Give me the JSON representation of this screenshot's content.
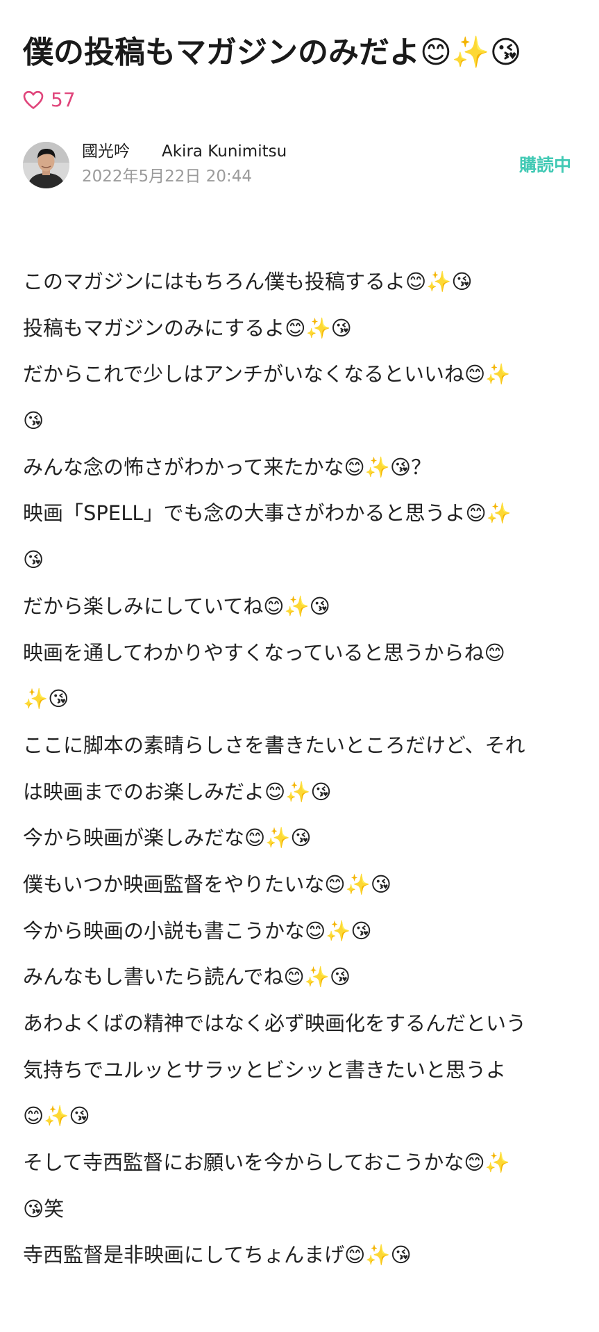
{
  "article": {
    "title": "僕の投稿もマガジンのみだよ😊✨😘",
    "like_count": "57",
    "like_icon": "heart-outline-icon"
  },
  "author": {
    "name": "國光吟　　Akira Kunimitsu",
    "date": "2022年5月22日 20:44",
    "follow_status": "購読中"
  },
  "colors": {
    "like_accent": "#e0457b",
    "follow_accent": "#41c9b4",
    "date_gray": "#9b9b9b"
  },
  "body_lines": [
    "このマガジンにはもちろん僕も投稿するよ😊✨😘",
    "投稿もマガジンのみにするよ😊✨😘",
    "だからこれで少しはアンチがいなくなるといいね😊✨",
    "😘",
    "みんな念の怖さがわかって来たかな😊✨😘？",
    "映画「SPELL」でも念の大事さがわかると思うよ😊✨",
    "😘",
    "だから楽しみにしていてね😊✨😘",
    "映画を通してわかりやすくなっていると思うからね😊",
    "✨😘",
    "ここに脚本の素晴らしさを書きたいところだけど、それ",
    "は映画までのお楽しみだよ😊✨😘",
    "今から映画が楽しみだな😊✨😘",
    "僕もいつか映画監督をやりたいな😊✨😘",
    "今から映画の小説も書こうかな😊✨😘",
    "みんなもし書いたら読んでね😊✨😘",
    "あわよくばの精神ではなく必ず映画化をするんだという",
    "気持ちでユルッとサラッとビシッと書きたいと思うよ",
    "😊✨😘",
    "そして寺西監督にお願いを今からしておこうかな😊✨",
    "😘笑",
    "寺西監督是非映画にしてちょんまげ😊✨😘"
  ]
}
